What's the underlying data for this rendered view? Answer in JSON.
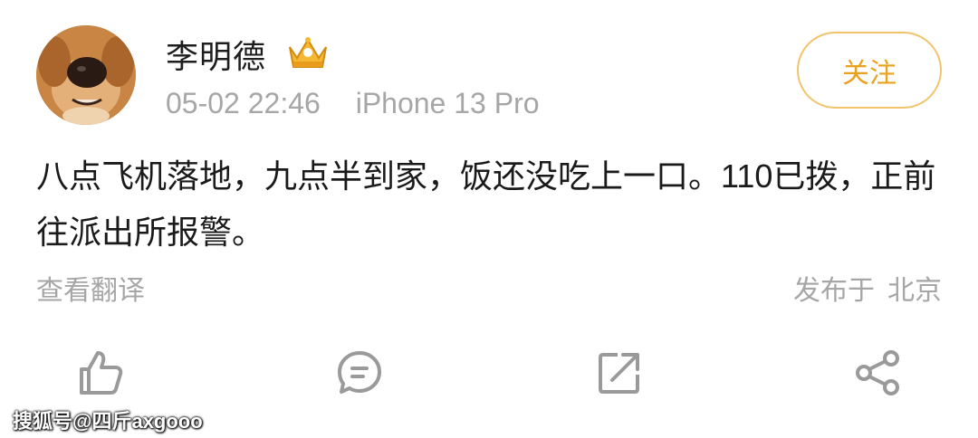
{
  "post": {
    "author": "李明德",
    "timestamp": "05-02 22:46",
    "device": "iPhone 13 Pro",
    "follow_label": "关注",
    "text": "八点飞机落地，九点半到家，饭还没吃上一口。110已拨，正前往派出所报警。",
    "translate_label": "查看翻译",
    "location_prefix": "发布于",
    "location": "北京"
  },
  "icons": {
    "avatar": "dog-avatar",
    "badge": "vip-crown-icon",
    "actions": [
      "like-icon",
      "comment-icon",
      "repost-icon",
      "share-icon"
    ]
  },
  "colors": {
    "follow_border": "#f2c46d",
    "follow_text": "#e8a21e",
    "muted_text": "#a6a6a6",
    "icon_gray": "#9a9a9a"
  },
  "watermark": "搜狐号@四斤axgooo"
}
